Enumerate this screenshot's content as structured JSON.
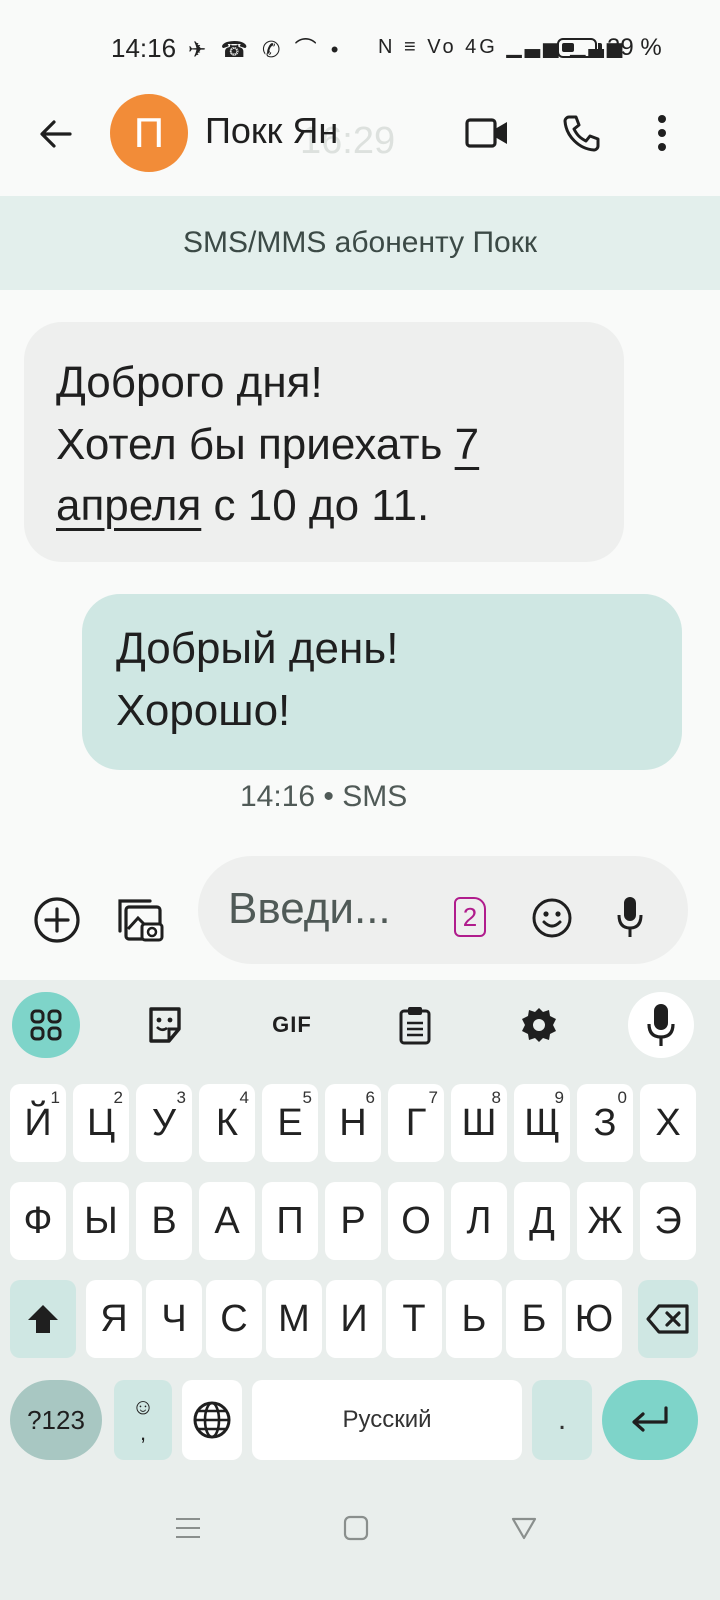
{
  "status_bar": {
    "time": "14:16",
    "left_icons": "✈ ☎ ✆ ⌒ •",
    "right_icons": "N ≡ Vo 4G ▁▃▅ ▁▃▅",
    "battery_percent": "39 %",
    "battery_level": 0.39
  },
  "app_bar": {
    "back_icon": "arrow-left-icon",
    "avatar_letter": "П",
    "avatar_color": "#f28c38",
    "contact_name": "Покк Ян",
    "ghost_time": "16:29",
    "video_icon": "video-camera-icon",
    "call_icon": "phone-icon",
    "more_icon": "more-vertical-icon"
  },
  "banner": {
    "text": "SMS/MMS абоненту Покк"
  },
  "messages": {
    "incoming": {
      "line1": "Доброго дня!",
      "line2_prefix": "Хотел бы приехать ",
      "date_link_part1": "7",
      "date_link_part2": "апреля",
      "line3_suffix": " с 10 до 11."
    },
    "outgoing": {
      "line1": "Добрый день!",
      "line2": "Хорошо!"
    },
    "meta": "14:16 • SMS"
  },
  "compose": {
    "placeholder": "Введи...",
    "sim_number": "2",
    "add_icon": "add-circle-icon",
    "gallery_icon": "gallery-icon",
    "emoji_icon": "emoji-icon",
    "mic_icon": "mic-icon"
  },
  "keyboard": {
    "toolbar": {
      "gif_label": "GIF"
    },
    "row1": [
      {
        "key": "Й",
        "hint": "1"
      },
      {
        "key": "Ц",
        "hint": "2"
      },
      {
        "key": "У",
        "hint": "3"
      },
      {
        "key": "К",
        "hint": "4"
      },
      {
        "key": "Е",
        "hint": "5"
      },
      {
        "key": "Н",
        "hint": "6"
      },
      {
        "key": "Г",
        "hint": "7"
      },
      {
        "key": "Ш",
        "hint": "8"
      },
      {
        "key": "Щ",
        "hint": "9"
      },
      {
        "key": "З",
        "hint": "0"
      },
      {
        "key": "Х",
        "hint": ""
      }
    ],
    "row2": [
      "Ф",
      "Ы",
      "В",
      "А",
      "П",
      "Р",
      "О",
      "Л",
      "Д",
      "Ж",
      "Э"
    ],
    "row3": [
      "Я",
      "Ч",
      "С",
      "М",
      "И",
      "Т",
      "Ь",
      "Б",
      "Ю"
    ],
    "num_label": "?123",
    "emoji_key_top": "☺",
    "emoji_key_bottom": ",",
    "space_label": "Русский",
    "dot_label": "."
  },
  "navbar": {
    "menu_icon": "menu-icon",
    "home_icon": "home-square-icon",
    "back_icon": "back-triangle-icon"
  },
  "colors": {
    "accent": "#7ed4c9",
    "outgoing_bubble": "#cfe7e3",
    "incoming_bubble": "#eeefee",
    "sim_badge": "#b01c8c"
  }
}
